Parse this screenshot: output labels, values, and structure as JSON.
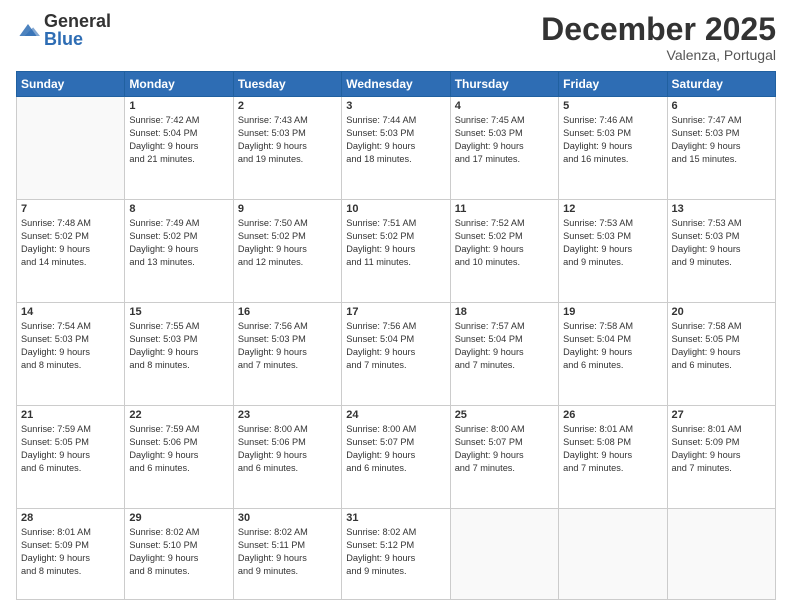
{
  "header": {
    "logo": {
      "general": "General",
      "blue": "Blue"
    },
    "title": "December 2025",
    "location": "Valenza, Portugal"
  },
  "calendar": {
    "days_of_week": [
      "Sunday",
      "Monday",
      "Tuesday",
      "Wednesday",
      "Thursday",
      "Friday",
      "Saturday"
    ],
    "weeks": [
      [
        {
          "day": "",
          "info": ""
        },
        {
          "day": "1",
          "info": "Sunrise: 7:42 AM\nSunset: 5:04 PM\nDaylight: 9 hours\nand 21 minutes."
        },
        {
          "day": "2",
          "info": "Sunrise: 7:43 AM\nSunset: 5:03 PM\nDaylight: 9 hours\nand 19 minutes."
        },
        {
          "day": "3",
          "info": "Sunrise: 7:44 AM\nSunset: 5:03 PM\nDaylight: 9 hours\nand 18 minutes."
        },
        {
          "day": "4",
          "info": "Sunrise: 7:45 AM\nSunset: 5:03 PM\nDaylight: 9 hours\nand 17 minutes."
        },
        {
          "day": "5",
          "info": "Sunrise: 7:46 AM\nSunset: 5:03 PM\nDaylight: 9 hours\nand 16 minutes."
        },
        {
          "day": "6",
          "info": "Sunrise: 7:47 AM\nSunset: 5:03 PM\nDaylight: 9 hours\nand 15 minutes."
        }
      ],
      [
        {
          "day": "7",
          "info": "Sunrise: 7:48 AM\nSunset: 5:02 PM\nDaylight: 9 hours\nand 14 minutes."
        },
        {
          "day": "8",
          "info": "Sunrise: 7:49 AM\nSunset: 5:02 PM\nDaylight: 9 hours\nand 13 minutes."
        },
        {
          "day": "9",
          "info": "Sunrise: 7:50 AM\nSunset: 5:02 PM\nDaylight: 9 hours\nand 12 minutes."
        },
        {
          "day": "10",
          "info": "Sunrise: 7:51 AM\nSunset: 5:02 PM\nDaylight: 9 hours\nand 11 minutes."
        },
        {
          "day": "11",
          "info": "Sunrise: 7:52 AM\nSunset: 5:02 PM\nDaylight: 9 hours\nand 10 minutes."
        },
        {
          "day": "12",
          "info": "Sunrise: 7:53 AM\nSunset: 5:03 PM\nDaylight: 9 hours\nand 9 minutes."
        },
        {
          "day": "13",
          "info": "Sunrise: 7:53 AM\nSunset: 5:03 PM\nDaylight: 9 hours\nand 9 minutes."
        }
      ],
      [
        {
          "day": "14",
          "info": "Sunrise: 7:54 AM\nSunset: 5:03 PM\nDaylight: 9 hours\nand 8 minutes."
        },
        {
          "day": "15",
          "info": "Sunrise: 7:55 AM\nSunset: 5:03 PM\nDaylight: 9 hours\nand 8 minutes."
        },
        {
          "day": "16",
          "info": "Sunrise: 7:56 AM\nSunset: 5:03 PM\nDaylight: 9 hours\nand 7 minutes."
        },
        {
          "day": "17",
          "info": "Sunrise: 7:56 AM\nSunset: 5:04 PM\nDaylight: 9 hours\nand 7 minutes."
        },
        {
          "day": "18",
          "info": "Sunrise: 7:57 AM\nSunset: 5:04 PM\nDaylight: 9 hours\nand 7 minutes."
        },
        {
          "day": "19",
          "info": "Sunrise: 7:58 AM\nSunset: 5:04 PM\nDaylight: 9 hours\nand 6 minutes."
        },
        {
          "day": "20",
          "info": "Sunrise: 7:58 AM\nSunset: 5:05 PM\nDaylight: 9 hours\nand 6 minutes."
        }
      ],
      [
        {
          "day": "21",
          "info": "Sunrise: 7:59 AM\nSunset: 5:05 PM\nDaylight: 9 hours\nand 6 minutes."
        },
        {
          "day": "22",
          "info": "Sunrise: 7:59 AM\nSunset: 5:06 PM\nDaylight: 9 hours\nand 6 minutes."
        },
        {
          "day": "23",
          "info": "Sunrise: 8:00 AM\nSunset: 5:06 PM\nDaylight: 9 hours\nand 6 minutes."
        },
        {
          "day": "24",
          "info": "Sunrise: 8:00 AM\nSunset: 5:07 PM\nDaylight: 9 hours\nand 6 minutes."
        },
        {
          "day": "25",
          "info": "Sunrise: 8:00 AM\nSunset: 5:07 PM\nDaylight: 9 hours\nand 7 minutes."
        },
        {
          "day": "26",
          "info": "Sunrise: 8:01 AM\nSunset: 5:08 PM\nDaylight: 9 hours\nand 7 minutes."
        },
        {
          "day": "27",
          "info": "Sunrise: 8:01 AM\nSunset: 5:09 PM\nDaylight: 9 hours\nand 7 minutes."
        }
      ],
      [
        {
          "day": "28",
          "info": "Sunrise: 8:01 AM\nSunset: 5:09 PM\nDaylight: 9 hours\nand 8 minutes."
        },
        {
          "day": "29",
          "info": "Sunrise: 8:02 AM\nSunset: 5:10 PM\nDaylight: 9 hours\nand 8 minutes."
        },
        {
          "day": "30",
          "info": "Sunrise: 8:02 AM\nSunset: 5:11 PM\nDaylight: 9 hours\nand 9 minutes."
        },
        {
          "day": "31",
          "info": "Sunrise: 8:02 AM\nSunset: 5:12 PM\nDaylight: 9 hours\nand 9 minutes."
        },
        {
          "day": "",
          "info": ""
        },
        {
          "day": "",
          "info": ""
        },
        {
          "day": "",
          "info": ""
        }
      ]
    ]
  }
}
